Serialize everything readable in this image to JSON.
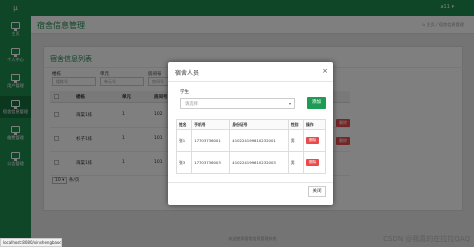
{
  "header": {
    "logo": "µ",
    "user": "a11 ▾"
  },
  "sidebar": {
    "items": [
      {
        "label": "主页",
        "icon": "monitor-icon"
      },
      {
        "label": "个人中心",
        "icon": "monitor-icon"
      },
      {
        "label": "用户管理",
        "icon": "monitor-icon"
      },
      {
        "label": "宿舍信息管理",
        "icon": "monitor-icon"
      },
      {
        "label": "缴费管理",
        "icon": "monitor-icon"
      },
      {
        "label": "公告管理",
        "icon": "monitor-icon"
      }
    ]
  },
  "page": {
    "title": "宿舍信息管理",
    "breadcrumb": "⌂ 主页 / 宿舍信息管理"
  },
  "panel": {
    "title": "宿舍信息列表",
    "filters": [
      {
        "label": "楼栋",
        "placeholder": "楼栋号"
      },
      {
        "label": "单元",
        "placeholder": "单元号"
      },
      {
        "label": "房间号",
        "placeholder": "房间号"
      }
    ],
    "columns": [
      "楼栋",
      "单元",
      "房间号"
    ],
    "rows": [
      {
        "building": "海棠1栋",
        "unit": "1",
        "room": "102",
        "btn": "删除"
      },
      {
        "building": "杉子1栋",
        "unit": "1",
        "room": "101",
        "btn": "删除"
      },
      {
        "building": "海棠1栋",
        "unit": "1",
        "room": "101",
        "btn": "删除"
      }
    ],
    "pager": {
      "size": "10 ▾",
      "suffix": "条/页"
    }
  },
  "footer": "欢迎使用宿舍信息管理系统",
  "status_url": "localhost:8080/xinshengbaodao/index.jsp",
  "watermark": "CSDN @我真的在拉拉QAQ",
  "modal": {
    "title": "宿舍人员",
    "close_icon": "×",
    "student_label": "学生",
    "student_placeholder": "请选择",
    "add_label": "添加",
    "columns": [
      "姓名",
      "手机号",
      "身份证号",
      "性别",
      "操作"
    ],
    "rows": [
      {
        "name": "张1",
        "phone": "17703736001",
        "id": "410224199610232001",
        "sex": "男",
        "action": "删除"
      },
      {
        "name": "张3",
        "phone": "17703736003",
        "id": "410224199610232003",
        "sex": "男",
        "action": "删除"
      }
    ],
    "close_label": "关闭"
  },
  "colors": {
    "primary": "#1e8c4e",
    "danger": "#e94b4b",
    "add": "#1e9c55"
  }
}
